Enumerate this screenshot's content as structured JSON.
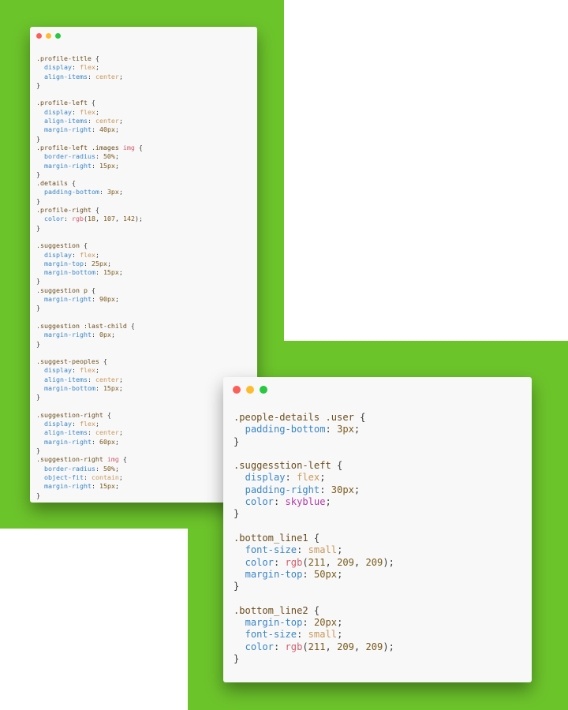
{
  "colors": {
    "background_green": "#6cc42b",
    "window_bg": "#f8f8f8",
    "dot_red": "#fc5f57",
    "dot_yellow": "#fdbc2e",
    "dot_green": "#28c840"
  },
  "window1": {
    "lines": [
      ".profile-title {",
      "  display: flex;",
      "  align-items: center;",
      "}",
      "",
      ".profile-left {",
      "  display: flex;",
      "  align-items: center;",
      "  margin-right: 40px;",
      "}",
      ".profile-left .images img {",
      "  border-radius: 50%;",
      "  margin-right: 15px;",
      "}",
      ".details {",
      "  padding-bottom: 3px;",
      "}",
      ".profile-right {",
      "  color: rgb(18, 107, 142);",
      "}",
      "",
      ".suggestion {",
      "  display: flex;",
      "  margin-top: 25px;",
      "  margin-bottom: 15px;",
      "}",
      ".suggestion p {",
      "  margin-right: 90px;",
      "}",
      "",
      ".suggestion :last-child {",
      "  margin-right: 0px;",
      "}",
      "",
      ".suggest-peoples {",
      "  display: flex;",
      "  align-items: center;",
      "  margin-bottom: 15px;",
      "}",
      "",
      ".suggestion-right {",
      "  display: flex;",
      "  align-items: center;",
      "  margin-right: 60px;",
      "}",
      ".suggestion-right img {",
      "  border-radius: 50%;",
      "  object-fit: contain;",
      "  margin-right: 15px;",
      "}"
    ]
  },
  "window2": {
    "lines": [
      ".people-details .user {",
      "  padding-bottom: 3px;",
      "}",
      "",
      ".suggesstion-left {",
      "  display: flex;",
      "  padding-right: 30px;",
      "  color: skyblue;",
      "}",
      "",
      ".bottom_line1 {",
      "  font-size: small;",
      "  color: rgb(211, 209, 209);",
      "  margin-top: 50px;",
      "}",
      "",
      ".bottom_line2 {",
      "  margin-top: 20px;",
      "  font-size: small;",
      "  color: rgb(211, 209, 209);",
      "}"
    ]
  }
}
